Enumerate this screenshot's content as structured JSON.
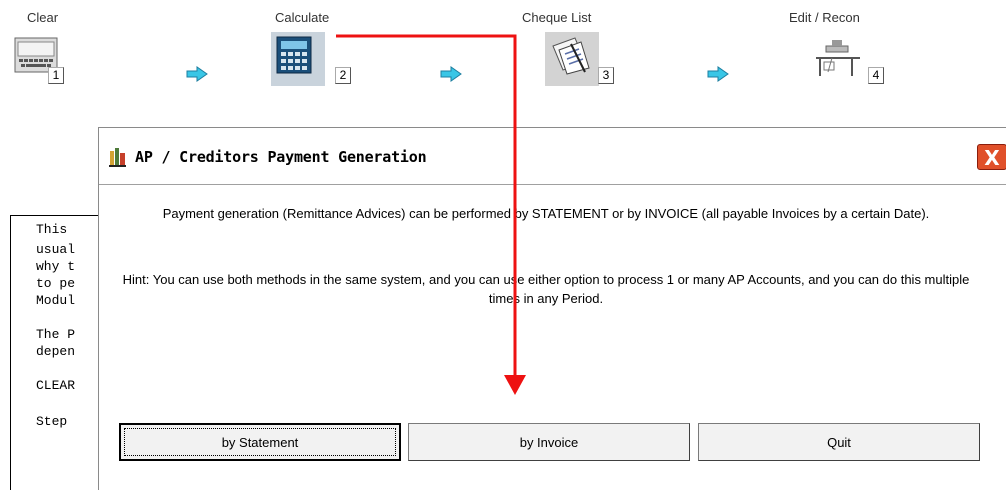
{
  "workflow": {
    "steps": [
      {
        "label": "Clear",
        "number": "1",
        "icon": "keyboard-icon"
      },
      {
        "label": "Calculate",
        "number": "2",
        "icon": "calculator-icon"
      },
      {
        "label": "Cheque List",
        "number": "3",
        "icon": "documents-icon"
      },
      {
        "label": "Edit / Recon",
        "number": "4",
        "icon": "desk-icon"
      }
    ],
    "arrow_color": "#39c6e6"
  },
  "background_doc": {
    "lines": [
      "This",
      "usual",
      "why t",
      "to pe",
      "Modul",
      "",
      "The P",
      "depen",
      "",
      "CLEAR",
      "",
      "Step"
    ]
  },
  "dialog": {
    "title": "AP / Creditors Payment Generation",
    "close_label": "X",
    "message1": "Payment generation (Remittance Advices) can be performed by STATEMENT or by INVOICE (all payable Invoices by a certain Date).",
    "message2": "Hint: You can use both methods in the same system, and you can use either option to process 1 or many AP Accounts, and you can do this multiple times in any Period.",
    "buttons": {
      "statement": "by Statement",
      "invoice": "by Invoice",
      "quit": "Quit"
    }
  },
  "annotation": {
    "color": "#ee1111"
  }
}
